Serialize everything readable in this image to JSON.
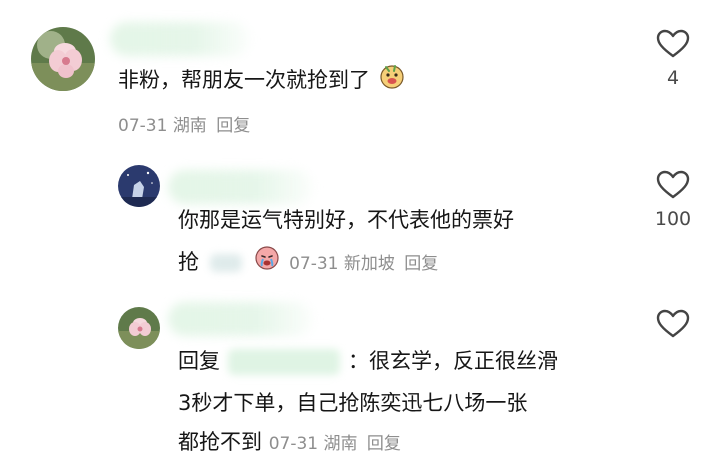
{
  "comments": [
    {
      "text": "非粉，帮朋友一次就抢到了",
      "date": "07-31",
      "location": "湖南",
      "reply_label": "回复",
      "like_count": "4"
    },
    {
      "text_line1": "你那是运气特别好，不代表他的票好",
      "text_line2": "抢",
      "date": "07-31",
      "location": "新加坡",
      "reply_label": "回复",
      "like_count": "100"
    },
    {
      "reply_prefix": "回复",
      "text_line1": "：很玄学，反正很丝滑",
      "text_line2": "3秒才下单，自己抢陈奕迅七八场一张",
      "text_line3": "都抢不到",
      "date": "07-31",
      "location": "湖南",
      "reply_label": "回复"
    }
  ],
  "icons": {
    "like": "heart-outline-icon",
    "emoji1": "laughing-face-emoji-icon",
    "emoji2": "crying-face-emoji-icon"
  },
  "colors": {
    "text": "#161616",
    "meta": "#8e8e8e",
    "like_stroke": "#444444"
  }
}
